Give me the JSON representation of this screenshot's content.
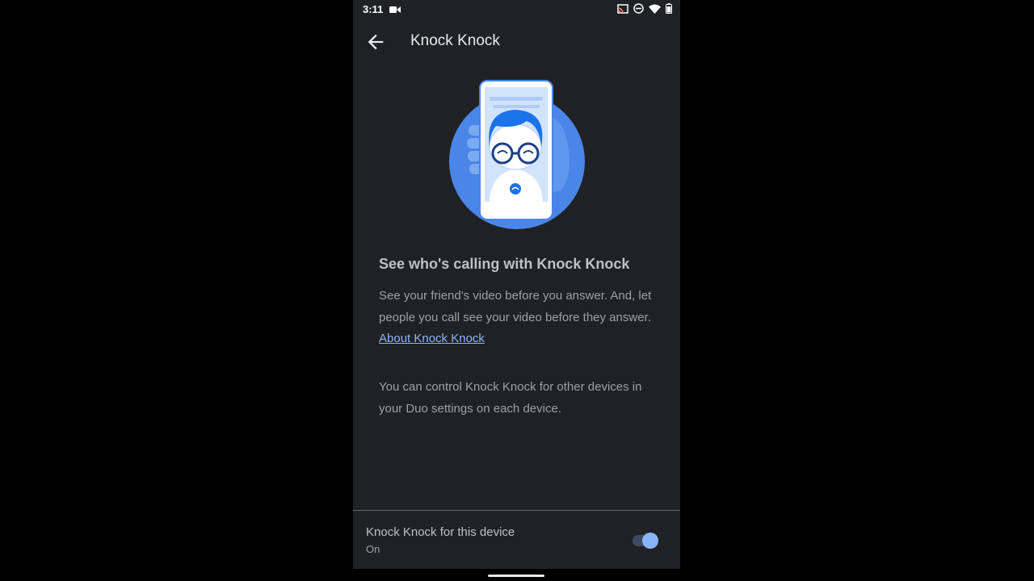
{
  "status_bar": {
    "time": "3:11",
    "icons": [
      "video-record-icon",
      "cast-icon",
      "do-not-disturb-icon",
      "wifi-icon",
      "battery-icon"
    ]
  },
  "app_bar": {
    "back_icon": "arrow-back-icon",
    "title": "Knock Knock"
  },
  "content": {
    "illustration": "phone-video-call-illustration",
    "heading": "See who's calling with Knock Knock",
    "description": "See your friend's video before you answer. And, let people you call see your video before they answer.",
    "link_label": "About Knock Knock",
    "note": "You can control Knock Knock for other devices in your Duo settings on each device."
  },
  "setting": {
    "title": "Knock Knock for this device",
    "subtitle": "On",
    "enabled": true
  },
  "colors": {
    "background": "#202124",
    "accent": "#8ab4f8",
    "illustration_blue": "#4a86e8"
  }
}
